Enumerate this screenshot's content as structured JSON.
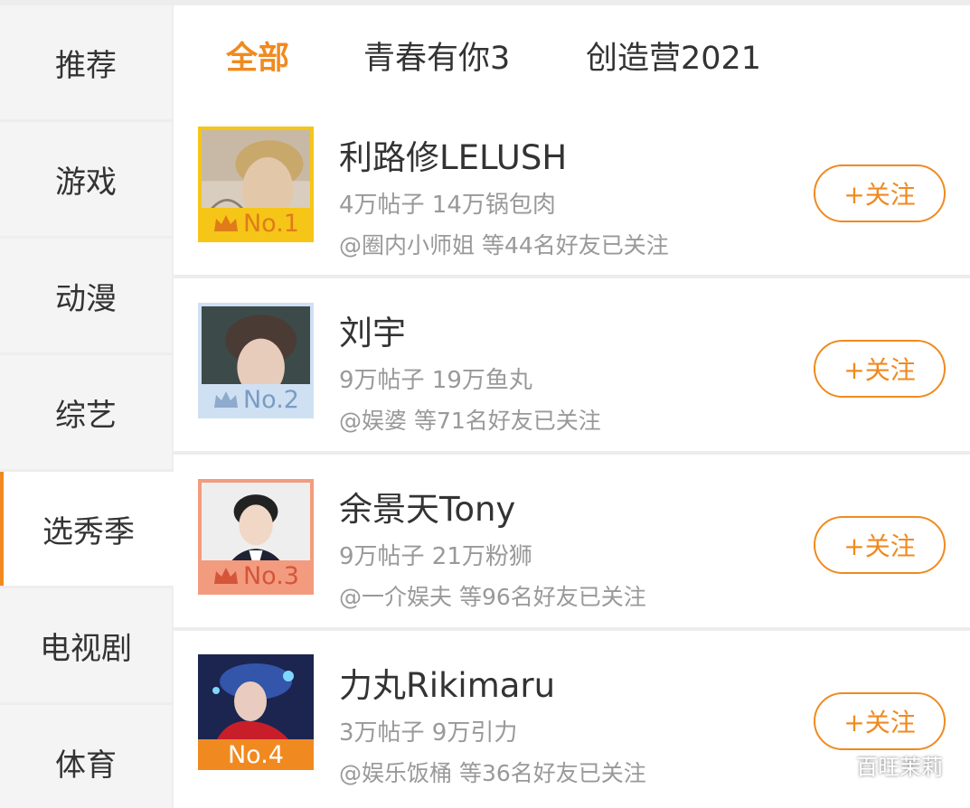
{
  "sidebar": {
    "items": [
      {
        "label": "推荐",
        "active": false
      },
      {
        "label": "游戏",
        "active": false
      },
      {
        "label": "动漫",
        "active": false
      },
      {
        "label": "综艺",
        "active": false
      },
      {
        "label": "选秀季",
        "active": true
      },
      {
        "label": "电视剧",
        "active": false
      },
      {
        "label": "体育",
        "active": false
      }
    ]
  },
  "tabs": [
    {
      "label": "全部",
      "active": true
    },
    {
      "label": "青春有你3",
      "active": false
    },
    {
      "label": "创造营2021",
      "active": false
    }
  ],
  "list": [
    {
      "rank": "No.1",
      "name": "利路修LELUSH",
      "stats": "4万帖子 14万锅包肉",
      "friends": "@圈内小师姐 等44名好友已关注",
      "follow_label": "+关注",
      "rank_color": "#f5c518",
      "rank_text_color": "#ffffff",
      "crown_color": "#e07b1a"
    },
    {
      "rank": "No.2",
      "name": "刘宇",
      "stats": "9万帖子 19万鱼丸",
      "friends": "@娱婆 等71名好友已关注",
      "follow_label": "+关注",
      "rank_color": "#cfe0f2",
      "rank_text_color": "#7a9cc4",
      "crown_color": "#8eaacd"
    },
    {
      "rank": "No.3",
      "name": "余景天Tony",
      "stats": "9万帖子 21万粉狮",
      "friends": "@一介娱夫 等96名好友已关注",
      "follow_label": "+关注",
      "rank_color": "#f39b7e",
      "rank_text_color": "#d4553a",
      "crown_color": "#d4553a"
    },
    {
      "rank": "No.4",
      "name": "力丸Rikimaru",
      "stats": "3万帖子 9万引力",
      "friends": "@娱乐饭桶 等36名好友已关注",
      "follow_label": "+关注",
      "rank_color": "#f08a20",
      "rank_text_color": "#ffffff",
      "crown_color": ""
    }
  ],
  "watermark": {
    "text": "百旺茉莉",
    "icon": "wechat-icon"
  },
  "colors": {
    "accent": "#f08a20",
    "secondary_text": "#999999"
  }
}
